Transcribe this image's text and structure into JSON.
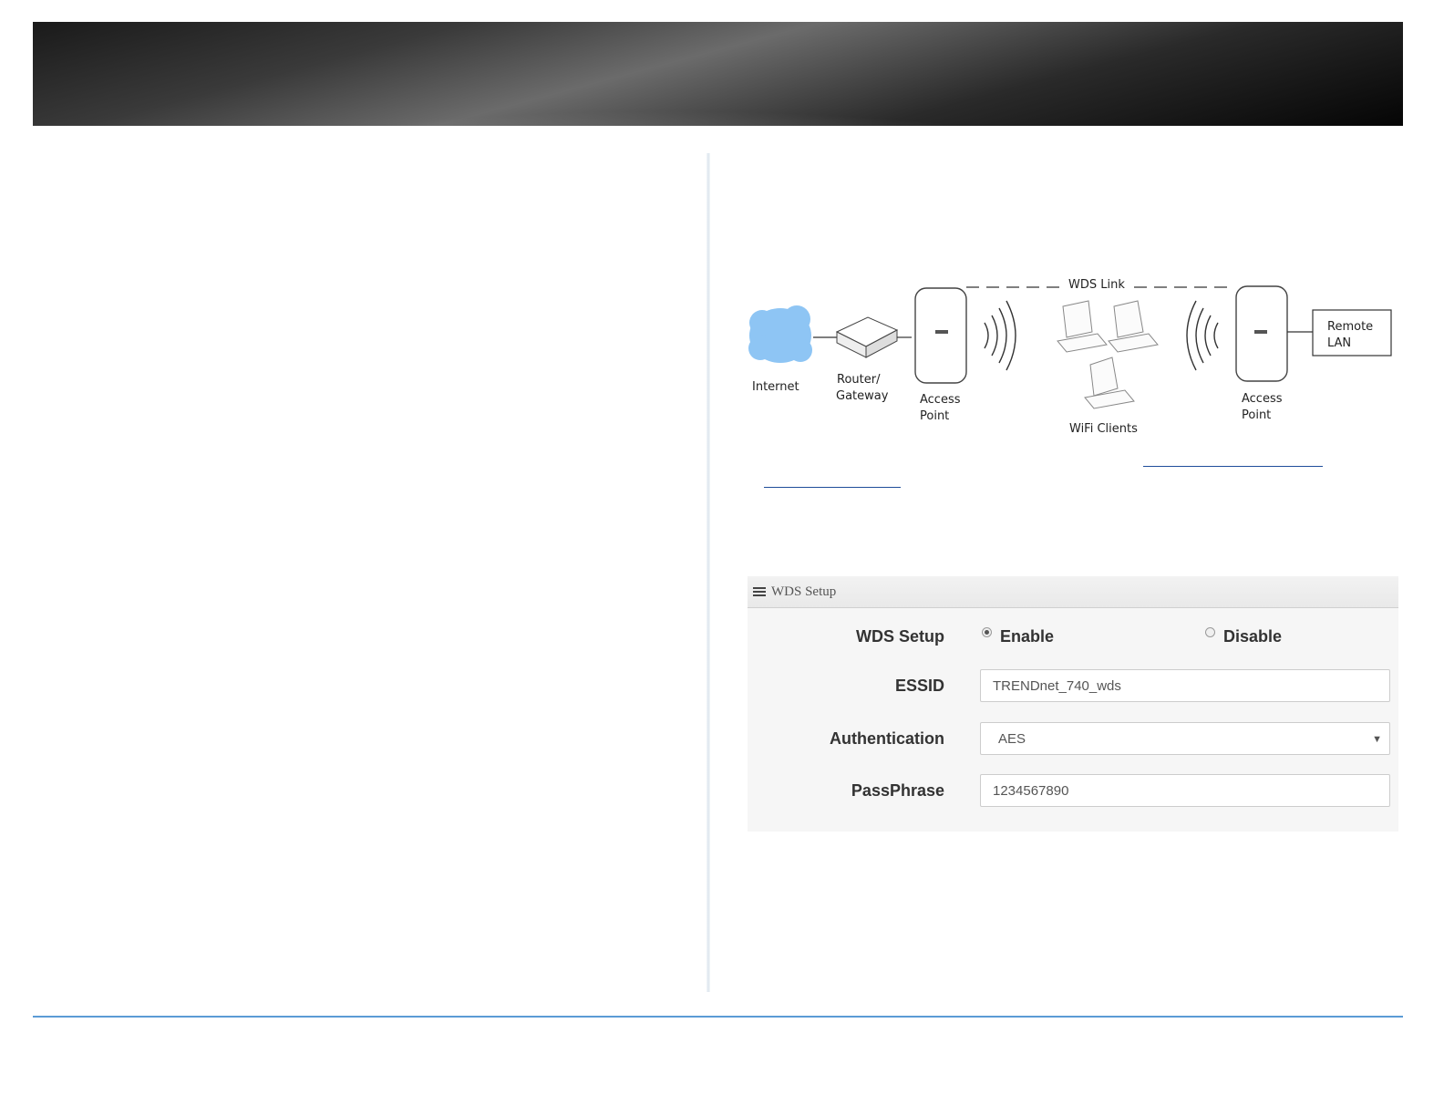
{
  "diagram": {
    "internet": "Internet",
    "router": [
      "Router/",
      "Gateway"
    ],
    "access_point_left": [
      "Access",
      "Point"
    ],
    "wds_link": "WDS Link",
    "wifi_clients": "WiFi Clients",
    "access_point_right": [
      "Access",
      "Point"
    ],
    "remote_lan": [
      "Remote",
      "LAN"
    ]
  },
  "panel": {
    "title": "WDS Setup",
    "rows": {
      "wds_setup": {
        "label": "WDS Setup",
        "enable": "Enable",
        "disable": "Disable",
        "selected": "Enable"
      },
      "essid": {
        "label": "ESSID",
        "value": "TRENDnet_740_wds"
      },
      "authentication": {
        "label": "Authentication",
        "value": "AES"
      },
      "passphrase": {
        "label": "PassPhrase",
        "value": "1234567890"
      }
    }
  },
  "colors": {
    "link": "#1f4e9a",
    "rule": "#5b9bd5",
    "cloud": "#8ec5f4"
  }
}
